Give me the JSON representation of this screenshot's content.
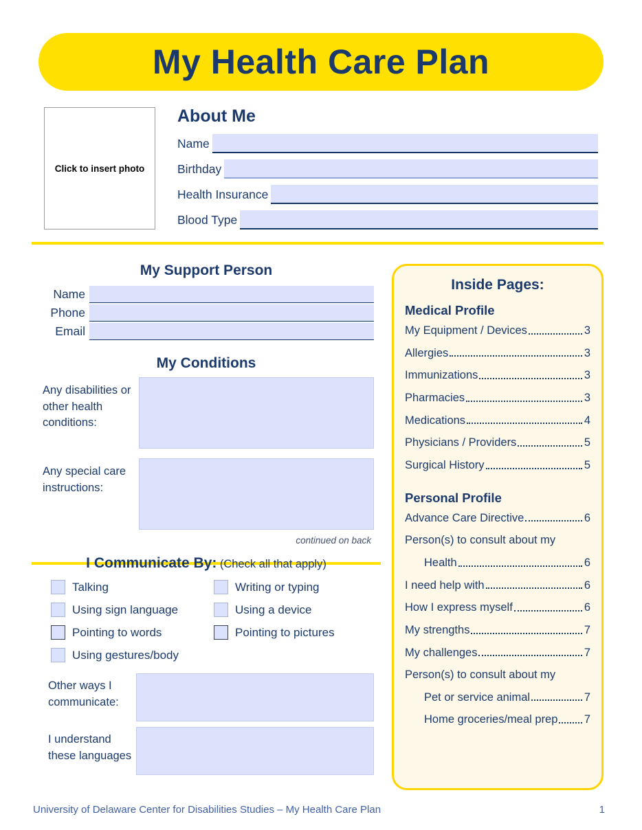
{
  "banner": {
    "title": "My Health Care Plan"
  },
  "about": {
    "photo_placeholder": "Click to insert photo",
    "heading": "About Me",
    "fields": [
      {
        "label": "Name",
        "value": ""
      },
      {
        "label": "Birthday",
        "value": ""
      },
      {
        "label": "Health Insurance",
        "value": ""
      },
      {
        "label": "Blood Type",
        "value": ""
      }
    ]
  },
  "support": {
    "heading": "My Support Person",
    "fields": [
      {
        "label": "Name",
        "value": ""
      },
      {
        "label": "Phone",
        "value": ""
      },
      {
        "label": "Email",
        "value": ""
      }
    ]
  },
  "conditions": {
    "heading": "My Conditions",
    "fields": [
      {
        "label": "Any disabilities or other health conditions:",
        "value": ""
      },
      {
        "label": "Any special care instructions:",
        "value": ""
      }
    ],
    "note": "continued on back"
  },
  "communicate": {
    "heading": "I Communicate By:",
    "subheading": "(Check all that apply)",
    "options_left": [
      {
        "label": "Talking",
        "checked": false
      },
      {
        "label": "Using sign language",
        "checked": false
      },
      {
        "label": "Pointing to words",
        "checked": false
      },
      {
        "label": "Using gestures/body",
        "checked": false
      }
    ],
    "options_right": [
      {
        "label": "Writing or typing",
        "checked": false
      },
      {
        "label": "Using a device",
        "checked": false
      },
      {
        "label": "Pointing to pictures",
        "checked": false
      }
    ],
    "other_fields": [
      {
        "label": "Other ways I communicate:",
        "value": ""
      },
      {
        "label": "I understand these languages",
        "value": ""
      }
    ]
  },
  "inside_pages": {
    "title": "Inside Pages:",
    "groups": [
      {
        "name": "Medical Profile",
        "items": [
          {
            "text": "My Equipment / Devices",
            "page": "3",
            "indent": false
          },
          {
            "text": "Allergies",
            "page": "3",
            "indent": false
          },
          {
            "text": "Immunizations",
            "page": "3",
            "indent": false
          },
          {
            "text": "Pharmacies ",
            "page": "3",
            "indent": false
          },
          {
            "text": "Medications",
            "page": "4",
            "indent": false
          },
          {
            "text": "Physicians / Providers",
            "page": "5",
            "indent": false
          },
          {
            "text": "Surgical History",
            "page": "5",
            "indent": false
          }
        ]
      },
      {
        "name": "Personal Profile",
        "items": [
          {
            "text": "Advance Care Directive",
            "page": "6",
            "indent": false
          },
          {
            "text": "Person(s)  to consult about my",
            "page": "",
            "indent": false,
            "nodots": true
          },
          {
            "text": "Health ",
            "page": "6",
            "indent": true
          },
          {
            "text": "I need help with ",
            "page": "6",
            "indent": false
          },
          {
            "text": "How I express myself",
            "page": "6",
            "indent": false
          },
          {
            "text": "My strengths ",
            "page": "7",
            "indent": false
          },
          {
            "text": "My challenges",
            "page": "7",
            "indent": false
          },
          {
            "text": "Person(s)  to consult about my",
            "page": "",
            "indent": false,
            "nodots": true
          },
          {
            "text": "Pet or service animal ",
            "page": "7",
            "indent": true
          },
          {
            "text": "Home groceries/meal prep",
            "page": "7",
            "indent": true
          }
        ]
      }
    ]
  },
  "footer": {
    "text": "University of Delaware Center for Disabilities Studies – My Health Care Plan",
    "page_number": "1"
  },
  "colors": {
    "banner_yellow": "#ffe000",
    "navy": "#1b3a6b",
    "field_blue": "#dce2fb",
    "panel_cream": "#fdf8e8",
    "panel_border": "#ffd400"
  }
}
